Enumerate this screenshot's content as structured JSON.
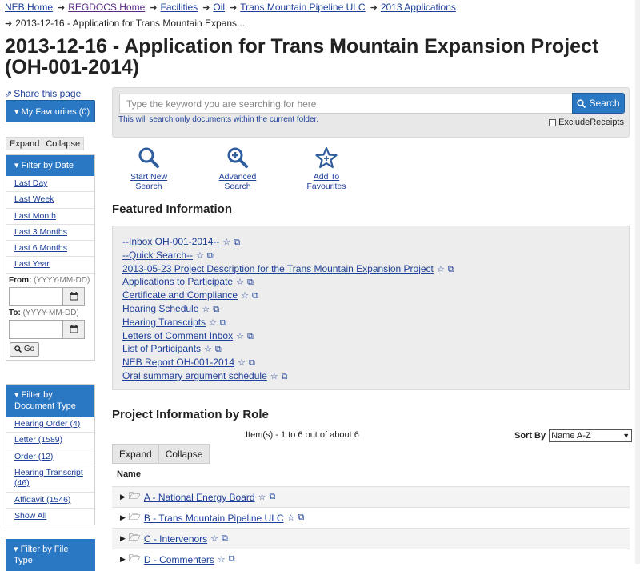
{
  "breadcrumb": {
    "items": [
      "NEB Home",
      "REGDOCS Home",
      "Facilities",
      "Oil",
      "Trans Mountain Pipeline ULC",
      "2013 Applications"
    ],
    "current": "2013-12-16 - Application for Trans Mountain Expans..."
  },
  "page": {
    "title": "2013-12-16 - Application for Trans Mountain Expansion Project (OH-001-2014)"
  },
  "sidebar": {
    "share_label": "Share this page",
    "favourites_label": "My Favourites (0)",
    "expand_label": "Expand",
    "collapse_label": "Collapse",
    "date_filter": {
      "header": "Filter by Date",
      "items": [
        "Last Day",
        "Last Week",
        "Last Month",
        "Last 3 Months",
        "Last 6 Months",
        "Last Year"
      ],
      "from_label": "From:",
      "from_hint": "(YYYY-MM-DD)",
      "to_label": "To:",
      "to_hint": "(YYYY-MM-DD)",
      "go_label": "Go"
    },
    "doc_type_filter": {
      "header": "Filter by Document Type",
      "items": [
        "Hearing Order (4)",
        "Letter (1589)",
        "Order (12)",
        "Hearing Transcript (46)",
        "Affidavit (1546)",
        "Show All"
      ]
    },
    "file_type_filter": {
      "header": "Filter by File Type"
    }
  },
  "search": {
    "placeholder": "Type the keyword you are searching for here",
    "button_label": "Search",
    "note": "This will search only documents within the current folder.",
    "exclude_receipts_label": "ExcludeReceipts",
    "exclude_receipts_checked": false
  },
  "actions": {
    "start_new_search": "Start New Search",
    "advanced_search": "Advanced Search",
    "add_to_favourites": "Add To Favourites"
  },
  "featured": {
    "heading": "Featured Information",
    "items": [
      "--Inbox OH-001-2014--",
      "--Quick Search--",
      "2013-05-23 Project Description for the Trans Mountain Expansion Project",
      "Applications to Participate",
      "Certificate and Compliance",
      "Hearing Schedule",
      "Hearing Transcripts",
      "Letters of Comment Inbox",
      "List of Participants",
      "NEB Report OH-001-2014",
      "Oral summary argument schedule"
    ]
  },
  "roles": {
    "heading": "Project Information by Role",
    "count_text": "Item(s) - 1 to 6 out of about 6",
    "sort_label": "Sort By",
    "sort_value": "Name A-Z",
    "expand_label": "Expand",
    "collapse_label": "Collapse",
    "name_header": "Name",
    "items": [
      "A - National Energy Board",
      "B - Trans Mountain Pipeline ULC",
      "C - Intervenors",
      "D - Commenters"
    ]
  },
  "colors": {
    "primary": "#2a78c4",
    "link": "#1d3f99",
    "visited": "#5a2a85"
  }
}
